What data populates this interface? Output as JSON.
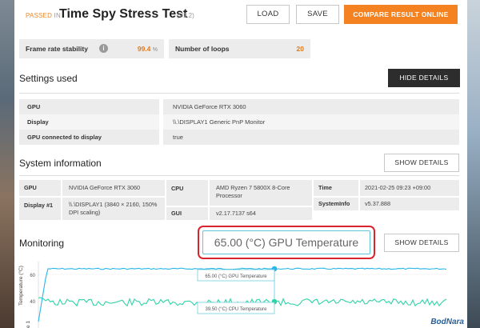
{
  "header": {
    "status": "PASSED",
    "status_in": "IN",
    "title": "Time Spy Stress Test",
    "version": "(V1.2)",
    "load_label": "LOAD",
    "save_label": "SAVE",
    "compare_label": "COMPARE RESULT ONLINE"
  },
  "stats": {
    "frame_rate_label": "Frame rate stability",
    "frame_rate_value": "99.4",
    "frame_rate_unit": "%",
    "loops_label": "Number of loops",
    "loops_value": "20"
  },
  "settings": {
    "title": "Settings used",
    "hide_label": "HIDE DETAILS",
    "rows": [
      {
        "key": "GPU",
        "value": "NVIDIA GeForce RTX 3060"
      },
      {
        "key": "Display",
        "value": "\\\\.\\DISPLAY1 Generic PnP Monitor"
      },
      {
        "key": "GPU connected to display",
        "value": "true"
      }
    ]
  },
  "system": {
    "title": "System information",
    "show_label": "SHOW DETAILS",
    "gpu_key": "GPU",
    "gpu_value": "NVIDIA GeForce RTX 3060",
    "display_key": "Display #1",
    "display_value": "\\\\.\\DISPLAY1 (3840 × 2160, 150% DPI scaling)",
    "cpu_key": "CPU",
    "cpu_value": "AMD Ryzen 7 5800X 8-Core Processor",
    "gui_key": "GUI",
    "gui_value": "v2.17.7137 s64",
    "time_key": "Time",
    "time_value": "2021-02-25 09:23 +09:00",
    "sysinfo_key": "SystemInfo",
    "sysinfo_value": "v5.37.888"
  },
  "monitoring": {
    "title": "Monitoring",
    "show_label": "SHOW DETAILS",
    "tooltip_big": "65.00 (°C) GPU Temperature",
    "gpu_tooltip": "65.00 (°C) GPU Temperature",
    "cpu_tooltip": "39.50 (°C) CPU Temperature",
    "y_label": "Temperature (°C)",
    "y_ticks": [
      "60",
      "40"
    ],
    "frame_rate_axis": "e 1"
  },
  "watermark": "BodNara",
  "colors": {
    "accent": "#f58220",
    "gpu_line": "#29b6e8",
    "cpu_line": "#2fd3a8",
    "highlight": "#d9232d"
  }
}
